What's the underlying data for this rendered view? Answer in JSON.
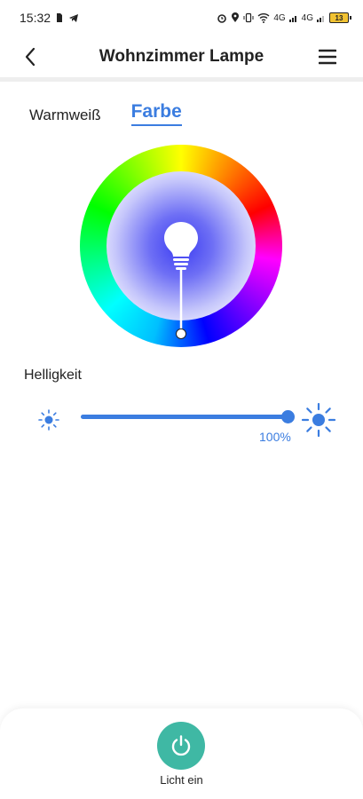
{
  "status_bar": {
    "time": "15:32",
    "signal_1": "4G",
    "signal_2": "4G",
    "battery": "13"
  },
  "header": {
    "title": "Wohnzimmer Lampe",
    "back_icon": "chevron-left-icon",
    "menu_icon": "hamburger-menu-icon"
  },
  "tabs": [
    {
      "label": "Warmweiß",
      "active": false
    },
    {
      "label": "Farbe",
      "active": true
    }
  ],
  "color_picker": {
    "selected_color": "#3b3cf2",
    "bulb_icon": "light-bulb-icon"
  },
  "brightness": {
    "label": "Helligkeit",
    "value": 100,
    "value_text": "100%",
    "min_icon": "sun-small-icon",
    "max_icon": "sun-large-icon"
  },
  "power": {
    "label": "Licht ein",
    "icon": "power-icon",
    "color": "#3fb8a4"
  },
  "colors": {
    "accent": "#3b7de0",
    "power": "#3fb8a4"
  }
}
